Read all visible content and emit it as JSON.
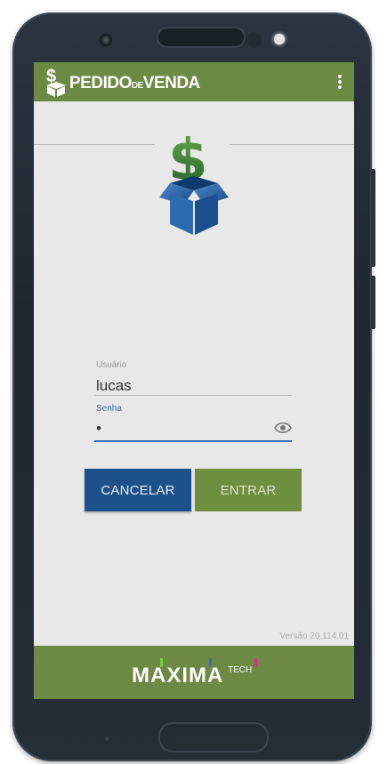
{
  "app": {
    "title_main": "PEDIDO",
    "title_de": "DE",
    "title_end": "VENDA",
    "menu_icon": "more-vert-icon"
  },
  "login": {
    "user_label": "Usuário",
    "user_value": "lucas",
    "password_label": "Senha",
    "password_value": "•",
    "visibility_icon": "eye-icon"
  },
  "buttons": {
    "cancel_label": "CANCELAR",
    "enter_label": "ENTRAR"
  },
  "version": "Versão 20.114.01",
  "footer": {
    "brand": "MAXIMA",
    "brand_suffix": "TECH"
  },
  "colors": {
    "appbar_green": "#6c8a43",
    "cancel_blue": "#1d5189",
    "enter_green": "#6f8f40",
    "accent_blue": "#3f6fb5"
  }
}
